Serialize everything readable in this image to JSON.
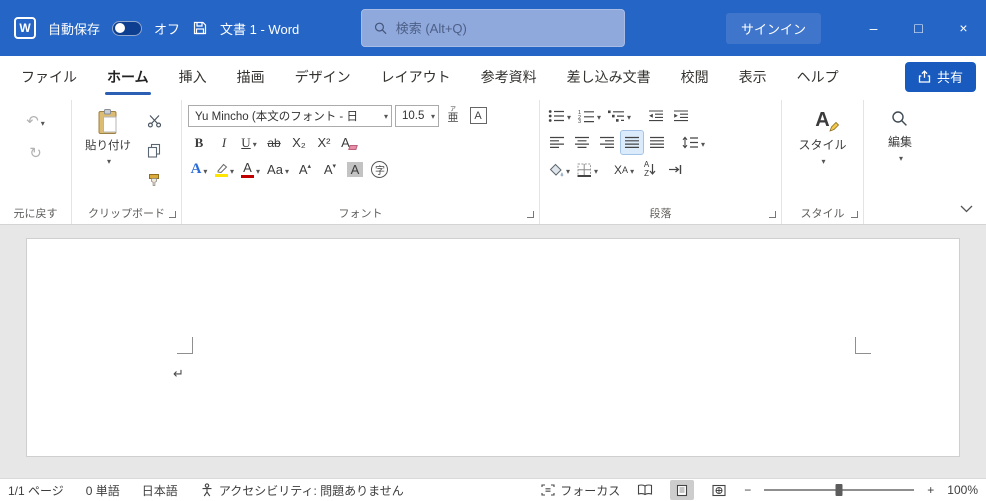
{
  "titlebar": {
    "autosave_label": "自動保存",
    "autosave_state": "オフ",
    "document_title": "文書 1  -  Word",
    "search_placeholder": "検索 (Alt+Q)",
    "signin_label": "サインイン"
  },
  "window_controls": {
    "minimize": "–",
    "maximize": "□",
    "close": "×"
  },
  "tabs": [
    {
      "label": "ファイル"
    },
    {
      "label": "ホーム"
    },
    {
      "label": "挿入"
    },
    {
      "label": "描画"
    },
    {
      "label": "デザイン"
    },
    {
      "label": "レイアウト"
    },
    {
      "label": "参考資料"
    },
    {
      "label": "差し込み文書"
    },
    {
      "label": "校閲"
    },
    {
      "label": "表示"
    },
    {
      "label": "ヘルプ"
    }
  ],
  "share_label": "共有",
  "ribbon": {
    "undo_group_label": "元に戻す",
    "clipboard": {
      "paste_label": "貼り付け",
      "group_label": "クリップボード"
    },
    "font": {
      "font_name": "Yu Mincho (本文のフォント - 日",
      "font_size": "10.5",
      "ruby_top": "ア",
      "ruby_base": "亜",
      "enclose_border": "A",
      "bold": "B",
      "italic": "I",
      "underline": "U",
      "strikethrough": "ab",
      "subscript": "X₂",
      "superscript": "X²",
      "clear_formatting": "A",
      "text_effects": "A",
      "font_color": "A",
      "change_case": "Aa",
      "grow_font": "A",
      "shrink_font": "A",
      "character_shading": "A",
      "enclose_character": "字",
      "group_label": "フォント"
    },
    "paragraph": {
      "sort_a": "A",
      "sort_z": "Z",
      "extended_x": "X",
      "extended_a": "A",
      "group_label": "段落"
    },
    "styles": {
      "icon_letter": "A",
      "button_label": "スタイル",
      "group_label": "スタイル"
    },
    "editing": {
      "button_label": "編集"
    }
  },
  "document": {
    "paragraph_mark": "↵"
  },
  "statusbar": {
    "page_info": "1/1 ページ",
    "word_count": "0 単語",
    "language": "日本語",
    "accessibility": "アクセシビリティ: 問題ありません",
    "focus": "フォーカス",
    "zoom_out": "−",
    "zoom_in": "+",
    "zoom_level": "100%"
  },
  "colors": {
    "titlebar_blue": "#2565c6",
    "brand_blue": "#185abd",
    "active_tab_underline": "#2b5fb4",
    "font_color_red": "#c00000",
    "highlight_yellow": "#ffe500"
  }
}
